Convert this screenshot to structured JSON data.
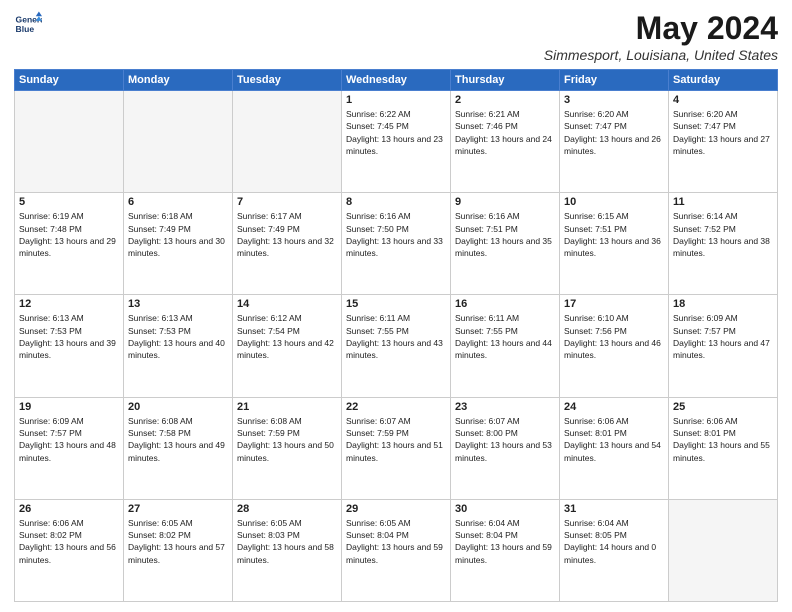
{
  "header": {
    "logo_line1": "General",
    "logo_line2": "Blue",
    "month_title": "May 2024",
    "location": "Simmesport, Louisiana, United States"
  },
  "days_of_week": [
    "Sunday",
    "Monday",
    "Tuesday",
    "Wednesday",
    "Thursday",
    "Friday",
    "Saturday"
  ],
  "weeks": [
    [
      {
        "day": "",
        "empty": true
      },
      {
        "day": "",
        "empty": true
      },
      {
        "day": "",
        "empty": true
      },
      {
        "day": "1",
        "sunrise": "6:22 AM",
        "sunset": "7:45 PM",
        "daylight": "13 hours and 23 minutes."
      },
      {
        "day": "2",
        "sunrise": "6:21 AM",
        "sunset": "7:46 PM",
        "daylight": "13 hours and 24 minutes."
      },
      {
        "day": "3",
        "sunrise": "6:20 AM",
        "sunset": "7:47 PM",
        "daylight": "13 hours and 26 minutes."
      },
      {
        "day": "4",
        "sunrise": "6:20 AM",
        "sunset": "7:47 PM",
        "daylight": "13 hours and 27 minutes."
      }
    ],
    [
      {
        "day": "5",
        "sunrise": "6:19 AM",
        "sunset": "7:48 PM",
        "daylight": "13 hours and 29 minutes."
      },
      {
        "day": "6",
        "sunrise": "6:18 AM",
        "sunset": "7:49 PM",
        "daylight": "13 hours and 30 minutes."
      },
      {
        "day": "7",
        "sunrise": "6:17 AM",
        "sunset": "7:49 PM",
        "daylight": "13 hours and 32 minutes."
      },
      {
        "day": "8",
        "sunrise": "6:16 AM",
        "sunset": "7:50 PM",
        "daylight": "13 hours and 33 minutes."
      },
      {
        "day": "9",
        "sunrise": "6:16 AM",
        "sunset": "7:51 PM",
        "daylight": "13 hours and 35 minutes."
      },
      {
        "day": "10",
        "sunrise": "6:15 AM",
        "sunset": "7:51 PM",
        "daylight": "13 hours and 36 minutes."
      },
      {
        "day": "11",
        "sunrise": "6:14 AM",
        "sunset": "7:52 PM",
        "daylight": "13 hours and 38 minutes."
      }
    ],
    [
      {
        "day": "12",
        "sunrise": "6:13 AM",
        "sunset": "7:53 PM",
        "daylight": "13 hours and 39 minutes."
      },
      {
        "day": "13",
        "sunrise": "6:13 AM",
        "sunset": "7:53 PM",
        "daylight": "13 hours and 40 minutes."
      },
      {
        "day": "14",
        "sunrise": "6:12 AM",
        "sunset": "7:54 PM",
        "daylight": "13 hours and 42 minutes."
      },
      {
        "day": "15",
        "sunrise": "6:11 AM",
        "sunset": "7:55 PM",
        "daylight": "13 hours and 43 minutes."
      },
      {
        "day": "16",
        "sunrise": "6:11 AM",
        "sunset": "7:55 PM",
        "daylight": "13 hours and 44 minutes."
      },
      {
        "day": "17",
        "sunrise": "6:10 AM",
        "sunset": "7:56 PM",
        "daylight": "13 hours and 46 minutes."
      },
      {
        "day": "18",
        "sunrise": "6:09 AM",
        "sunset": "7:57 PM",
        "daylight": "13 hours and 47 minutes."
      }
    ],
    [
      {
        "day": "19",
        "sunrise": "6:09 AM",
        "sunset": "7:57 PM",
        "daylight": "13 hours and 48 minutes."
      },
      {
        "day": "20",
        "sunrise": "6:08 AM",
        "sunset": "7:58 PM",
        "daylight": "13 hours and 49 minutes."
      },
      {
        "day": "21",
        "sunrise": "6:08 AM",
        "sunset": "7:59 PM",
        "daylight": "13 hours and 50 minutes."
      },
      {
        "day": "22",
        "sunrise": "6:07 AM",
        "sunset": "7:59 PM",
        "daylight": "13 hours and 51 minutes."
      },
      {
        "day": "23",
        "sunrise": "6:07 AM",
        "sunset": "8:00 PM",
        "daylight": "13 hours and 53 minutes."
      },
      {
        "day": "24",
        "sunrise": "6:06 AM",
        "sunset": "8:01 PM",
        "daylight": "13 hours and 54 minutes."
      },
      {
        "day": "25",
        "sunrise": "6:06 AM",
        "sunset": "8:01 PM",
        "daylight": "13 hours and 55 minutes."
      }
    ],
    [
      {
        "day": "26",
        "sunrise": "6:06 AM",
        "sunset": "8:02 PM",
        "daylight": "13 hours and 56 minutes."
      },
      {
        "day": "27",
        "sunrise": "6:05 AM",
        "sunset": "8:02 PM",
        "daylight": "13 hours and 57 minutes."
      },
      {
        "day": "28",
        "sunrise": "6:05 AM",
        "sunset": "8:03 PM",
        "daylight": "13 hours and 58 minutes."
      },
      {
        "day": "29",
        "sunrise": "6:05 AM",
        "sunset": "8:04 PM",
        "daylight": "13 hours and 59 minutes."
      },
      {
        "day": "30",
        "sunrise": "6:04 AM",
        "sunset": "8:04 PM",
        "daylight": "13 hours and 59 minutes."
      },
      {
        "day": "31",
        "sunrise": "6:04 AM",
        "sunset": "8:05 PM",
        "daylight": "14 hours and 0 minutes."
      },
      {
        "day": "",
        "empty": true
      }
    ]
  ]
}
